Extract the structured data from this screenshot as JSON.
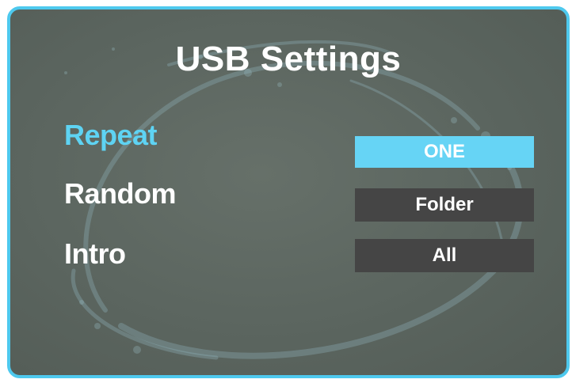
{
  "title": "USB Settings",
  "settings": [
    {
      "label": "Repeat",
      "value": "ONE",
      "selected": true
    },
    {
      "label": "Random",
      "value": "Folder",
      "selected": false
    },
    {
      "label": "Intro",
      "value": "All",
      "selected": false
    }
  ],
  "colors": {
    "frame_border": "#4ec9ee",
    "background": "#5b655f",
    "selected_text": "#5ed3f3",
    "selected_box": "#66d4f5",
    "value_box": "#454545",
    "text": "#ffffff"
  }
}
